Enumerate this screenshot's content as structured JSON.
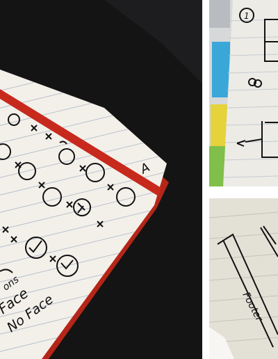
{
  "image": {
    "panels": [
      {
        "name": "notebook-grid-of-sketches",
        "photo": "notebook-photo"
      },
      {
        "name": "page-layout-sketch",
        "photo": "notepad-photo"
      },
      {
        "name": "footer-sketch",
        "photo": "notepad-photo"
      }
    ],
    "handwriting": {
      "page_number": "1",
      "main_corner_mark": "A",
      "main_words": [
        "ons",
        "Face",
        "No Face"
      ],
      "footer_word": "Footer"
    },
    "colors": {
      "table": "#151515",
      "notebook_band": "#c8291d",
      "notebook_page": "#f3f0ea",
      "ink": "#111111",
      "notepad_page": "#ece9e1",
      "rule_lines": "#b9c2cc"
    }
  }
}
